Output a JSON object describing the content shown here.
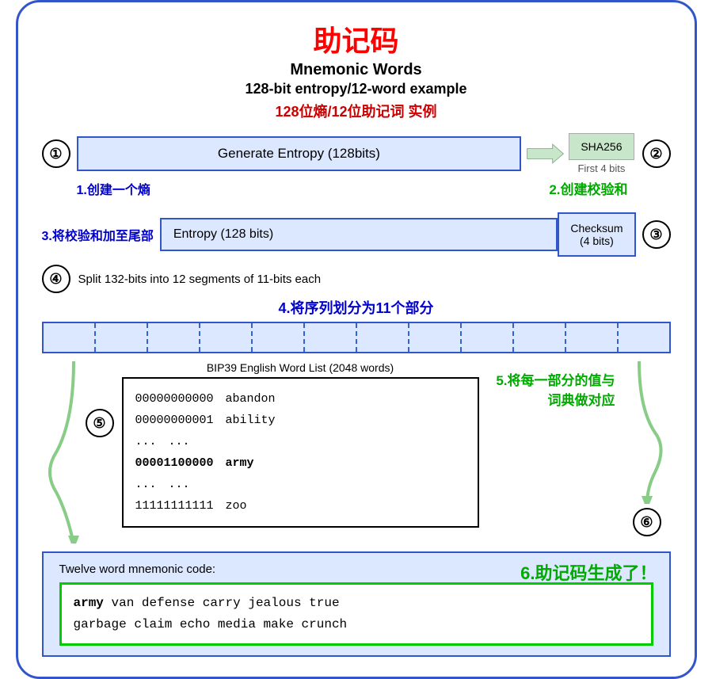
{
  "title": {
    "zh": "助记码",
    "en_main": "Mnemonic Words",
    "en_sub": "128-bit entropy/12-word example",
    "zh_sub": "128位熵/12位助记词 实例"
  },
  "step1": {
    "circle": "①",
    "label": "Generate Entropy (128bits)",
    "annotation": "1.创建一个熵",
    "sha_label": "SHA256",
    "first4bits": "First 4 bits",
    "step2_label": "2.创建校验和",
    "circle2": "②"
  },
  "step3": {
    "annotation": "3.将校验和加至尾部",
    "entropy_label": "Entropy (128 bits)",
    "checksum_label": "Checksum\n(4 bits)",
    "circle": "③"
  },
  "step4": {
    "circle": "④",
    "label": "Split 132-bits into 12 segments of 11-bits each",
    "zh_label": "4.将序列划分为11个部分",
    "segments": 12
  },
  "bip39": {
    "title": "BIP39 English Word List (2048 words)",
    "rows": [
      {
        "bits": "00000000000",
        "word": "abandon"
      },
      {
        "bits": "00000000001",
        "word": "ability"
      },
      {
        "bits": "...",
        "word": "..."
      },
      {
        "bits": "00001100000",
        "word": "army",
        "bold": true
      },
      {
        "bits": "...",
        "word": "..."
      },
      {
        "bits": "11111111111",
        "word": "zoo"
      }
    ]
  },
  "step5": {
    "circle": "⑤",
    "label": "5.将每一部分的值与词典做对应"
  },
  "step6": {
    "circle": "⑥",
    "label": "6.助记码生成了！"
  },
  "bottom": {
    "label": "Twelve word mnemonic code:",
    "mnemonic": "army van defense carry jealous true\ngarbage claim echo media make crunch",
    "mnemonic_first": "army",
    "mnemonic_rest": " van defense carry jealous true\ngarbage claim echo media make crunch"
  }
}
